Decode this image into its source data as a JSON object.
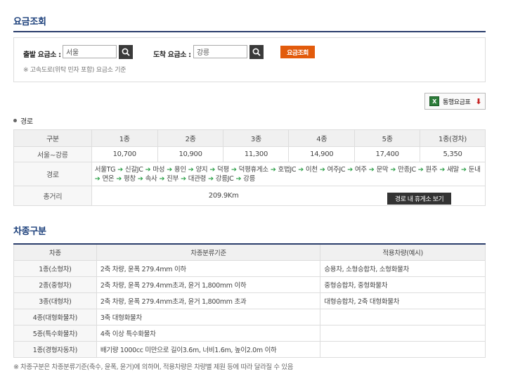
{
  "page_title": "요금조회",
  "search": {
    "depart_label": "출발 요금소 :",
    "depart_value": "서울",
    "arrive_label": "도착 요금소 :",
    "arrive_value": "강릉",
    "fare_button": "요금조회",
    "note": "※ 고속도로(위탁 민자 포함) 요금소 기준"
  },
  "toll_table_button": "통행요금표",
  "route_section_label": "경로",
  "fare_table": {
    "headers": [
      "구분",
      "1종",
      "2종",
      "3종",
      "4종",
      "5종",
      "1종(경차)"
    ],
    "fare_row_label": "서울~강릉",
    "fares": [
      "10,700",
      "10,900",
      "11,300",
      "14,900",
      "17,400",
      "5,350"
    ],
    "route_label": "경로",
    "route_stops": [
      "서울TG",
      "신갈JC",
      "마성",
      "용인",
      "양지",
      "덕평",
      "덕평휴게소",
      "호법JC",
      "이천",
      "여주JC",
      "여주",
      "문막",
      "만종JC",
      "원주",
      "새말",
      "둔내",
      "면온",
      "평창",
      "속사",
      "진부",
      "대관령",
      "강릉JC",
      "강릉"
    ],
    "distance_label": "총거리",
    "distance_value": "209.9Km",
    "rest_area_button": "경로 내 휴게소 보기"
  },
  "vehicle_section_title": "차종구분",
  "vehicle_table": {
    "headers": [
      "차종",
      "차종분류기준",
      "적용차량(예시)"
    ],
    "rows": [
      {
        "type": "1종(소형차)",
        "criteria": "2축 차량, 윤폭 279.4mm 이하",
        "example": "승용차, 소형승합차, 소형화물차"
      },
      {
        "type": "2종(중형차)",
        "criteria": "2축 차량, 윤폭 279.4mm초과, 윤거 1,800mm 이하",
        "example": "중형승합차, 중형화물차"
      },
      {
        "type": "3종(대형차)",
        "criteria": "2축 차량, 윤폭 279.4mm초과, 윤거 1,800mm 초과",
        "example": "대형승합차, 2축 대형화물차"
      },
      {
        "type": "4종(대형화물차)",
        "criteria": "3축 대형화물차",
        "example": ""
      },
      {
        "type": "5종(특수화물차)",
        "criteria": "4축 이상 특수화물차",
        "example": ""
      },
      {
        "type": "1종(경형자동차)",
        "criteria": "배기량 1000cc 미만으로 길이3.6m, 너비1.6m, 높이2.0m 이하",
        "example": ""
      }
    ]
  },
  "footer_note": "※ 차종구분은 차종분류기준(축수, 윤폭, 윤거)에 의하며, 적용차량은 차량별 제원 등에 따라 달라질 수 있음"
}
